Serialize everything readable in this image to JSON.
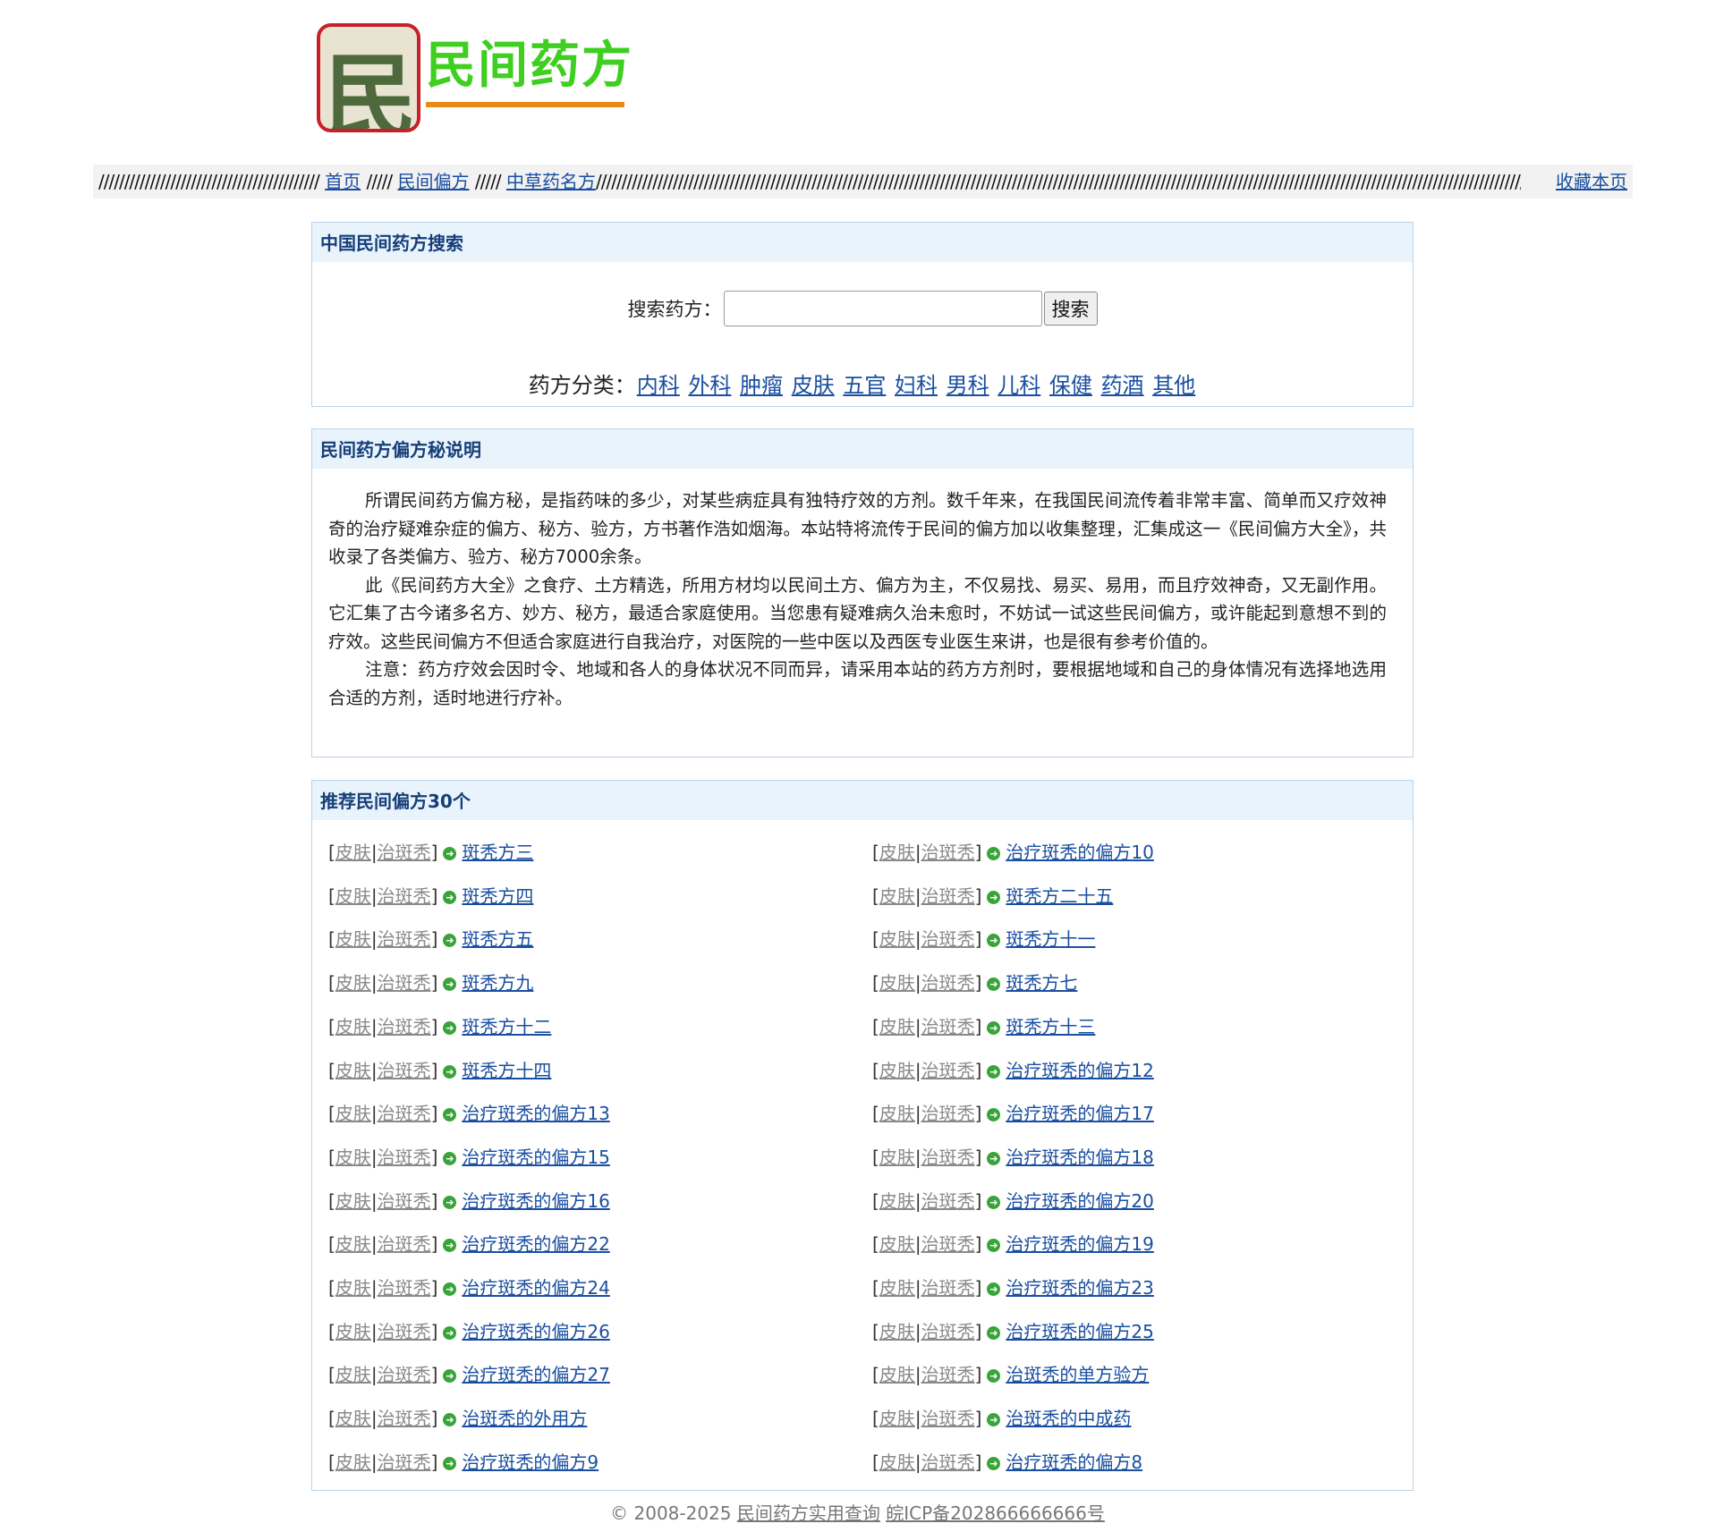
{
  "logo": {
    "seal_char": "民",
    "text": "民间药方"
  },
  "nav": {
    "sep_lead": "///////////////////////////////////////////",
    "sep_mid": "/////",
    "sep_trail": "//////////////////////////////////////////////////////////////////////////////////////////////////////////////////////////////////////////////////////////////////////////////////////////////////////////////////////////////////////////////////////////////////////////",
    "home": "首页",
    "folk": "民间偏方",
    "herbal": "中草药名方",
    "favorite": "收藏本页"
  },
  "search": {
    "title": "中国民间药方搜索",
    "label": "搜索药方：",
    "input_value": "",
    "button": "搜索",
    "cat_label": "药方分类：",
    "categories": [
      "内科",
      "外科",
      "肿瘤",
      "皮肤",
      "五官",
      "妇科",
      "男科",
      "儿科",
      "保健",
      "药酒",
      "其他"
    ]
  },
  "intro": {
    "title": "民间药方偏方秘说明",
    "p1": "所谓民间药方偏方秘，是指药味的多少，对某些病症具有独特疗效的方剂。数千年来，在我国民间流传着非常丰富、简单而又疗效神奇的治疗疑难杂症的偏方、秘方、验方，方书著作浩如烟海。本站特将流传于民间的偏方加以收集整理，汇集成这一《民间偏方大全》，共收录了各类偏方、验方、秘方7000余条。",
    "p2": "此《民间药方大全》之食疗、土方精选，所用方材均以民间土方、偏方为主，不仅易找、易买、易用，而且疗效神奇，又无副作用。它汇集了古今诸多名方、妙方、秘方，最适合家庭使用。当您患有疑难病久治未愈时，不妨试一试这些民间偏方，或许能起到意想不到的疗效。这些民间偏方不但适合家庭进行自我治疗，对医院的一些中医以及西医专业医生来讲，也是很有参考价值的。",
    "p3": "注意：药方疗效会因时令、地域和各人的身体状况不同而异，请采用本站的药方方剂时，要根据地域和自己的身体情况有选择地选用合适的方剂，适时地进行疗补。"
  },
  "recommend": {
    "title": "推荐民间偏方30个",
    "tag1": "皮肤",
    "tag2": "治斑秃",
    "bracket_open": "[",
    "bracket_mid": "|",
    "bracket_close": "]",
    "left": [
      "斑秃方三",
      "斑秃方四",
      "斑秃方五",
      "斑秃方九",
      "斑秃方十二",
      "斑秃方十四",
      "治疗斑秃的偏方13",
      "治疗斑秃的偏方15",
      "治疗斑秃的偏方16",
      "治疗斑秃的偏方22",
      "治疗斑秃的偏方24",
      "治疗斑秃的偏方26",
      "治疗斑秃的偏方27",
      "治斑秃的外用方",
      "治疗斑秃的偏方9"
    ],
    "right": [
      "治疗斑秃的偏方10",
      "斑秃方二十五",
      "斑秃方十一",
      "斑秃方七",
      "斑秃方十三",
      "治疗斑秃的偏方12",
      "治疗斑秃的偏方17",
      "治疗斑秃的偏方18",
      "治疗斑秃的偏方20",
      "治疗斑秃的偏方19",
      "治疗斑秃的偏方23",
      "治疗斑秃的偏方25",
      "治斑秃的单方验方",
      "治斑秃的中成药",
      "治疗斑秃的偏方8"
    ]
  },
  "footer": {
    "copyright": "© 2008-2025",
    "site": "民间药方实用查询",
    "icp": "皖ICP备202866666666号"
  }
}
